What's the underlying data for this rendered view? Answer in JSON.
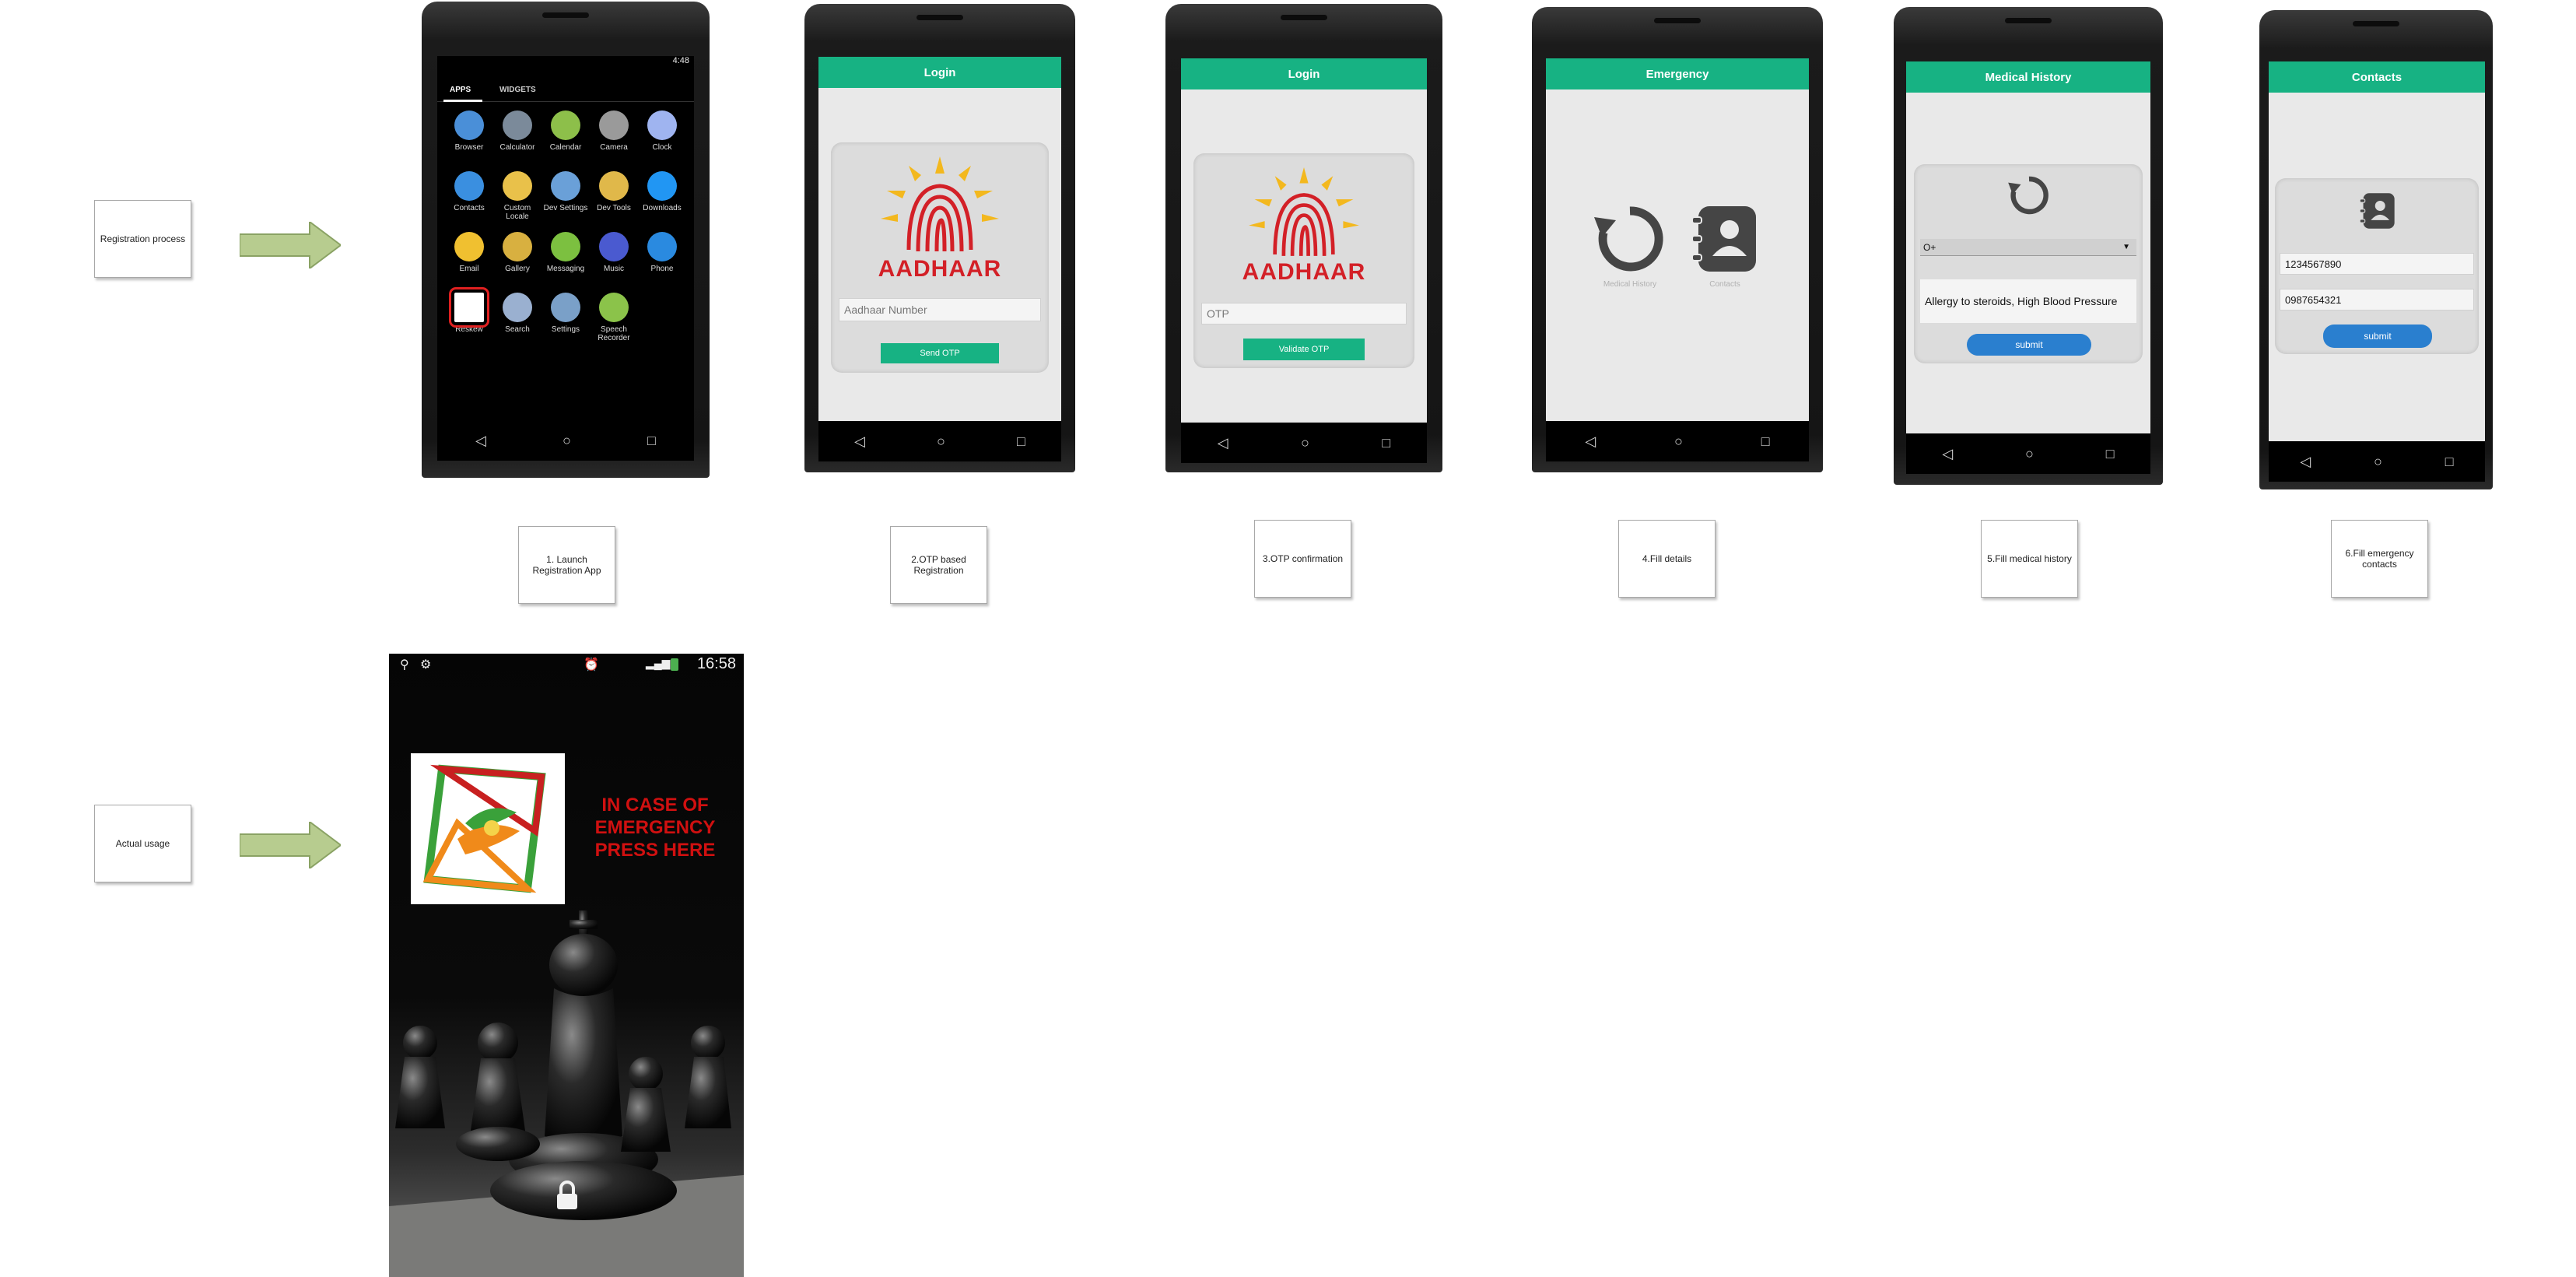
{
  "rows": {
    "registration_label": "Registration process",
    "usage_label": "Actual usage"
  },
  "steps": [
    {
      "label": "1. Launch\nRegistration App"
    },
    {
      "label": "2.OTP based\nRegistration"
    },
    {
      "label": "3.OTP confirmation"
    },
    {
      "label": "4.Fill details"
    },
    {
      "label": "5.Fill medical history"
    },
    {
      "label": "6.Fill emergency\ncontacts"
    }
  ],
  "screen1": {
    "status_time": "4:48",
    "tabs": [
      "APPS",
      "WIDGETS"
    ],
    "apps": [
      "Browser",
      "Calculator",
      "Calendar",
      "Camera",
      "Clock",
      "Contacts",
      "Custom\nLocale",
      "Dev Settings",
      "Dev Tools",
      "Downloads",
      "Email",
      "Gallery",
      "Messaging",
      "Music",
      "Phone",
      "Reskew",
      "Search",
      "Settings",
      "Speech\nRecorder"
    ]
  },
  "screen2": {
    "title": "Login",
    "logo_text": "AADHAAR",
    "input_placeholder": "Aadhaar Number",
    "button": "Send OTP"
  },
  "screen3": {
    "title": "Login",
    "logo_text": "AADHAAR",
    "input_placeholder": "OTP",
    "button": "Validate OTP"
  },
  "screen4": {
    "title": "Emergency",
    "option1": "Medical History",
    "option2": "Contacts"
  },
  "screen5": {
    "title": "Medical History",
    "blood_group": "O+",
    "conditions": "Allergy to steroids, High Blood Pressure",
    "button": "submit"
  },
  "screen6": {
    "title": "Contacts",
    "contact1": "1234567890",
    "contact2": "0987654321",
    "button": "submit"
  },
  "lockscreen": {
    "time": "16:58",
    "emergency_text": "IN CASE OF\nEMERGENCY\nPRESS HERE"
  },
  "colors": {
    "accent_green": "#17b283",
    "button_blue": "#2a7fcf",
    "aadhaar_red": "#d32027",
    "emergency_red": "#d01010",
    "arrow_fill": "#b7cc8f"
  }
}
